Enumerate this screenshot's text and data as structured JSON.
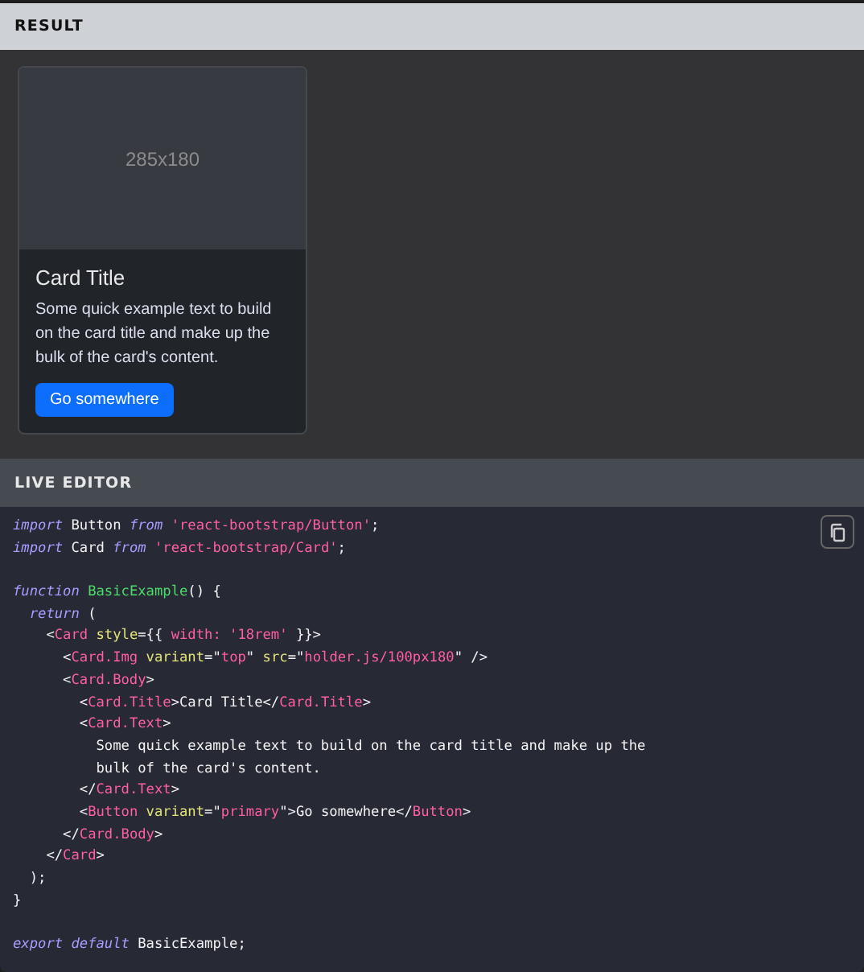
{
  "result": {
    "title": "RESULT",
    "card": {
      "image_label": "285x180",
      "title": "Card Title",
      "text": "Some quick example text to build on the card title and make up the bulk of the card's content.",
      "button": "Go somewhere"
    }
  },
  "editor": {
    "title": "LIVE EDITOR",
    "code": [
      {
        "kind": "code",
        "tokens": [
          {
            "kind": "keyword",
            "text": "import"
          },
          {
            "kind": "plain",
            "text": " Button "
          },
          {
            "kind": "keyword",
            "text": "from"
          },
          {
            "kind": "string",
            "text": " 'react-bootstrap/Button'"
          },
          {
            "kind": "plain",
            "text": ";"
          }
        ]
      },
      {
        "kind": "code",
        "tokens": [
          {
            "kind": "keyword",
            "text": "import"
          },
          {
            "kind": "plain",
            "text": " Card "
          },
          {
            "kind": "keyword",
            "text": "from"
          },
          {
            "kind": "string",
            "text": " 'react-bootstrap/Card'"
          },
          {
            "kind": "plain",
            "text": ";"
          }
        ]
      },
      {
        "kind": "blank"
      },
      {
        "kind": "code",
        "tokens": [
          {
            "kind": "keyword",
            "text": "function"
          },
          {
            "kind": "func",
            "text": " BasicExample"
          },
          {
            "kind": "plain",
            "text": "() {"
          }
        ]
      },
      {
        "kind": "code",
        "tokens": [
          {
            "kind": "keyword",
            "text": "  return"
          },
          {
            "kind": "plain",
            "text": " ("
          }
        ]
      },
      {
        "kind": "code",
        "tokens": [
          {
            "kind": "plain",
            "text": "    <"
          },
          {
            "kind": "tag",
            "text": "Card"
          },
          {
            "kind": "attr",
            "text": " style"
          },
          {
            "kind": "plain",
            "text": "={{ "
          },
          {
            "kind": "string",
            "text": "width: '18rem'"
          },
          {
            "kind": "plain",
            "text": " }}>"
          }
        ]
      },
      {
        "kind": "code",
        "tokens": [
          {
            "kind": "plain",
            "text": "      <"
          },
          {
            "kind": "tag",
            "text": "Card.Img"
          },
          {
            "kind": "attr",
            "text": " variant"
          },
          {
            "kind": "plain",
            "text": "=\""
          },
          {
            "kind": "string",
            "text": "top"
          },
          {
            "kind": "plain",
            "text": "\" "
          },
          {
            "kind": "attr",
            "text": "src"
          },
          {
            "kind": "plain",
            "text": "=\""
          },
          {
            "kind": "string",
            "text": "holder.js/100px180"
          },
          {
            "kind": "plain",
            "text": "\" />"
          }
        ]
      },
      {
        "kind": "code",
        "tokens": [
          {
            "kind": "plain",
            "text": "      <"
          },
          {
            "kind": "tag",
            "text": "Card.Body"
          },
          {
            "kind": "plain",
            "text": ">"
          }
        ]
      },
      {
        "kind": "code",
        "tokens": [
          {
            "kind": "plain",
            "text": "        <"
          },
          {
            "kind": "tag",
            "text": "Card.Title"
          },
          {
            "kind": "plain",
            "text": ">Card Title</"
          },
          {
            "kind": "tag",
            "text": "Card.Title"
          },
          {
            "kind": "plain",
            "text": ">"
          }
        ]
      },
      {
        "kind": "code",
        "tokens": [
          {
            "kind": "plain",
            "text": "        <"
          },
          {
            "kind": "tag",
            "text": "Card.Text"
          },
          {
            "kind": "plain",
            "text": ">"
          }
        ]
      },
      {
        "kind": "code",
        "tokens": [
          {
            "kind": "plain",
            "text": "          Some quick example text to build on the card title and make up the"
          }
        ]
      },
      {
        "kind": "code",
        "tokens": [
          {
            "kind": "plain",
            "text": "          bulk of the card's content."
          }
        ]
      },
      {
        "kind": "code",
        "tokens": [
          {
            "kind": "plain",
            "text": "        </"
          },
          {
            "kind": "tag",
            "text": "Card.Text"
          },
          {
            "kind": "plain",
            "text": ">"
          }
        ]
      },
      {
        "kind": "code",
        "tokens": [
          {
            "kind": "plain",
            "text": "        <"
          },
          {
            "kind": "tag",
            "text": "Button"
          },
          {
            "kind": "attr",
            "text": " variant"
          },
          {
            "kind": "plain",
            "text": "=\""
          },
          {
            "kind": "string",
            "text": "primary"
          },
          {
            "kind": "plain",
            "text": "\">Go somewhere</"
          },
          {
            "kind": "tag",
            "text": "Button"
          },
          {
            "kind": "plain",
            "text": ">"
          }
        ]
      },
      {
        "kind": "code",
        "tokens": [
          {
            "kind": "plain",
            "text": "      </"
          },
          {
            "kind": "tag",
            "text": "Card.Body"
          },
          {
            "kind": "plain",
            "text": ">"
          }
        ]
      },
      {
        "kind": "code",
        "tokens": [
          {
            "kind": "plain",
            "text": "    </"
          },
          {
            "kind": "tag",
            "text": "Card"
          },
          {
            "kind": "plain",
            "text": ">"
          }
        ]
      },
      {
        "kind": "code",
        "tokens": [
          {
            "kind": "plain",
            "text": "  );"
          }
        ]
      },
      {
        "kind": "code",
        "tokens": [
          {
            "kind": "plain",
            "text": "}"
          }
        ]
      },
      {
        "kind": "blank"
      },
      {
        "kind": "code",
        "tokens": [
          {
            "kind": "keyword",
            "text": "export"
          },
          {
            "kind": "keyword",
            "text": " default"
          },
          {
            "kind": "plain",
            "text": " BasicExample;"
          }
        ]
      }
    ]
  }
}
